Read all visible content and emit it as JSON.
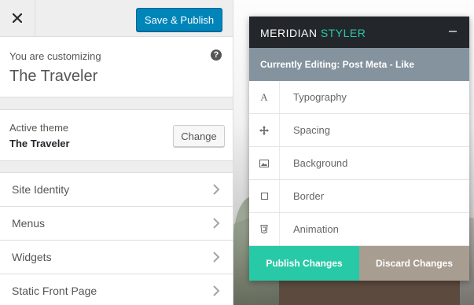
{
  "customizer": {
    "close_icon": "close-icon",
    "save_label": "Save & Publish",
    "customizing_label": "You are customizing",
    "site_title": "The Traveler",
    "help_icon": "?",
    "active_theme_label": "Active theme",
    "active_theme_name": "The Traveler",
    "change_label": "Change",
    "sections": [
      {
        "label": "Site Identity"
      },
      {
        "label": "Menus"
      },
      {
        "label": "Widgets"
      },
      {
        "label": "Static Front Page"
      }
    ]
  },
  "styler": {
    "brand_main": "MERIDIAN",
    "brand_accent": "STYLER",
    "editing_label": "Currently Editing: Post Meta - Like",
    "items": [
      {
        "label": "Typography",
        "icon": "typography-icon"
      },
      {
        "label": "Spacing",
        "icon": "move-icon"
      },
      {
        "label": "Background",
        "icon": "image-icon"
      },
      {
        "label": "Border",
        "icon": "square-icon"
      },
      {
        "label": "Animation",
        "icon": "css3-icon"
      }
    ],
    "publish_label": "Publish Changes",
    "discard_label": "Discard Changes"
  },
  "colors": {
    "primary_button": "#0085ba",
    "styler_accent": "#28c9a6",
    "discard_button": "#a89d91",
    "styler_header": "#23272b",
    "styler_subheader": "#84939e"
  }
}
